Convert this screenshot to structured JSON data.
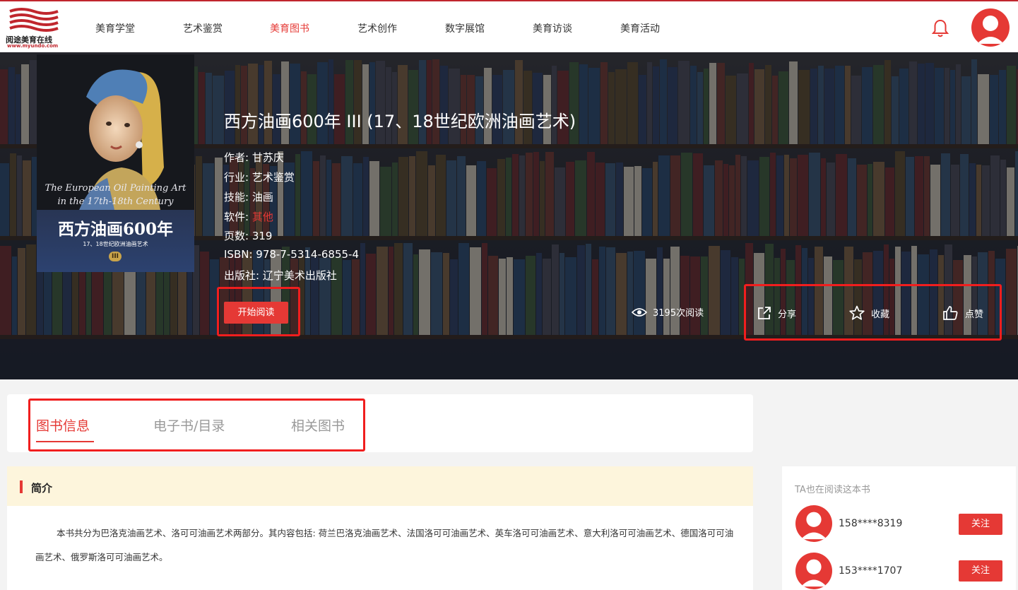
{
  "brand": {
    "name": "阅途美育在线",
    "url": "www.myundo.com",
    "accent": "#e53935"
  },
  "nav": {
    "items": [
      {
        "label": "美育学堂",
        "active": false
      },
      {
        "label": "艺术鉴赏",
        "active": false
      },
      {
        "label": "美育图书",
        "active": true
      },
      {
        "label": "艺术创作",
        "active": false
      },
      {
        "label": "数字展馆",
        "active": false
      },
      {
        "label": "美育访谈",
        "active": false
      },
      {
        "label": "美育活动",
        "active": false
      }
    ],
    "bell_icon": "bell-icon",
    "avatar_icon": "user-avatar-icon"
  },
  "book": {
    "title": "西方油画600年 III (17、18世纪欧洲油画艺术)",
    "cover": {
      "en_line1": "The European Oil Painting Art",
      "en_line2": "in the 17th-18th Century",
      "cn_title": "西方油画600年",
      "subtitle": "17、18世纪欧洲油画艺术",
      "volume": "III"
    },
    "meta": [
      {
        "label": "作者:",
        "value": "甘苏庆",
        "highlight": false
      },
      {
        "label": "行业:",
        "value": "艺术鉴赏",
        "highlight": false
      },
      {
        "label": "技能:",
        "value": "油画",
        "highlight": false
      },
      {
        "label": "软件:",
        "value": "其他",
        "highlight": true
      },
      {
        "label": "页数:",
        "value": "319",
        "highlight": false
      },
      {
        "label": "ISBN:",
        "value": "978-7-5314-6855-4",
        "highlight": false
      },
      {
        "label": "出版社:",
        "value": "辽宁美术出版社",
        "highlight": false
      }
    ],
    "read_button": "开始阅读",
    "views": "3195次阅读",
    "share": "分享",
    "favorite": "收藏",
    "like": "点赞"
  },
  "tabs": [
    {
      "label": "图书信息",
      "active": true
    },
    {
      "label": "电子书/目录",
      "active": false
    },
    {
      "label": "相关图书",
      "active": false
    }
  ],
  "intro": {
    "title": "简介",
    "text": "本书共分为巴洛克油画艺术、洛可可油画艺术两部分。其内容包括: 荷兰巴洛克油画艺术、法国洛可可油画艺术、英车洛可可油画艺术、意大利洛可可油画艺术、德国洛可可油画艺术、俄罗斯洛可可油画艺术。"
  },
  "readers": {
    "title": "TA也在阅读这本书",
    "list": [
      {
        "name": "158****8319",
        "follow": "关注"
      },
      {
        "name": "153****1707",
        "follow": "关注"
      }
    ]
  }
}
